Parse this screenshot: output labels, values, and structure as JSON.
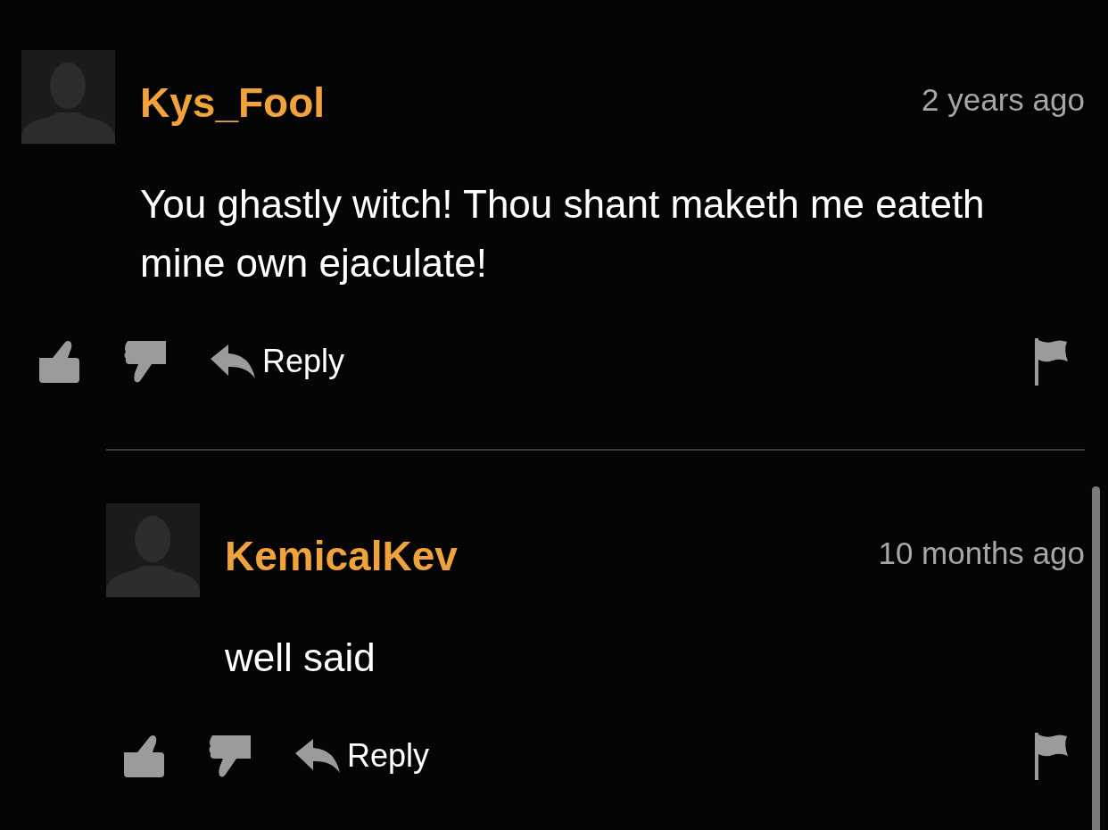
{
  "comments": [
    {
      "username": "Kys_Fool",
      "time": "2 years ago",
      "text": "You ghastly witch! Thou shant maketh me eateth mine own ejaculate!",
      "reply_label": "Reply",
      "children": [
        {
          "username": "KemicalKev",
          "time": "10 months ago",
          "text": "well said",
          "reply_label": "Reply"
        }
      ]
    }
  ]
}
